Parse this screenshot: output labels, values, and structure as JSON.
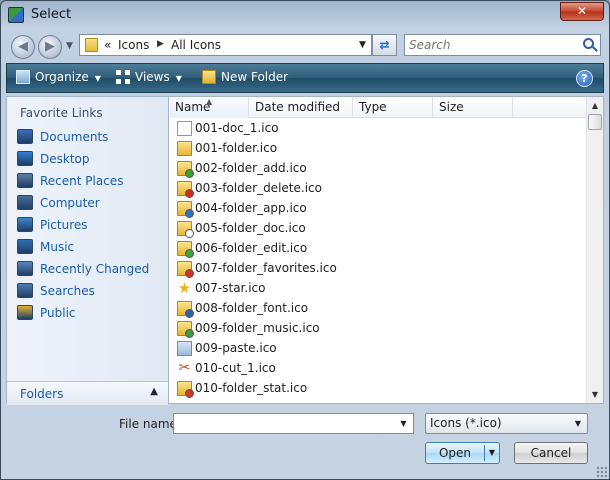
{
  "window": {
    "title": "Select",
    "close_glyph": "✕"
  },
  "address": {
    "overflow": "«",
    "parts": [
      "Icons",
      "All Icons"
    ],
    "search_placeholder": "Search"
  },
  "toolbar": {
    "organize": "Organize",
    "views": "Views",
    "new_folder": "New Folder",
    "help": "?"
  },
  "sidebar": {
    "title": "Favorite Links",
    "items": [
      {
        "label": "Documents",
        "icon": "documents-icon",
        "color": "#3a6fb6"
      },
      {
        "label": "Desktop",
        "icon": "desktop-icon",
        "color": "#2f7fd8"
      },
      {
        "label": "Recent Places",
        "icon": "recent-places-icon",
        "color": "#5f7ea3"
      },
      {
        "label": "Computer",
        "icon": "computer-icon",
        "color": "#4b6d96"
      },
      {
        "label": "Pictures",
        "icon": "pictures-icon",
        "color": "#3d87c9"
      },
      {
        "label": "Music",
        "icon": "music-icon",
        "color": "#2a6fb4"
      },
      {
        "label": "Recently Changed",
        "icon": "recently-changed-icon",
        "color": "#5b86bd"
      },
      {
        "label": "Searches",
        "icon": "searches-icon",
        "color": "#4f7cb3"
      },
      {
        "label": "Public",
        "icon": "public-folder-icon",
        "color": "#e1b234"
      }
    ],
    "folders_label": "Folders"
  },
  "columns": [
    "Name",
    "Date modified",
    "Type",
    "Size"
  ],
  "files": [
    {
      "name": "001-doc_1.ico",
      "icon": "doc"
    },
    {
      "name": "001-folder.ico",
      "icon": "folder"
    },
    {
      "name": "002-folder_add.ico",
      "icon": "folder",
      "badge": "#37a22e"
    },
    {
      "name": "003-folder_delete.ico",
      "icon": "folder",
      "badge": "#d32a1f"
    },
    {
      "name": "004-folder_app.ico",
      "icon": "folder",
      "badge": "#2f6fc6"
    },
    {
      "name": "005-folder_doc.ico",
      "icon": "folder",
      "badge": "#ffffff"
    },
    {
      "name": "006-folder_edit.ico",
      "icon": "folder",
      "badge": "#3aa63a"
    },
    {
      "name": "007-folder_favorites.ico",
      "icon": "folder",
      "badge": "#d9312a"
    },
    {
      "name": "007-star.ico",
      "icon": "star"
    },
    {
      "name": "008-folder_font.ico",
      "icon": "folder",
      "badge": "#2c62b6"
    },
    {
      "name": "009-folder_music.ico",
      "icon": "folder",
      "badge": "#3a9d43"
    },
    {
      "name": "009-paste.ico",
      "icon": "paste"
    },
    {
      "name": "010-cut_1.ico",
      "icon": "cut"
    },
    {
      "name": "010-folder_stat.ico",
      "icon": "folder",
      "badge": "#cf3b2c"
    }
  ],
  "bottom": {
    "filename_label": "File name:",
    "filename_value": "",
    "filter": "Icons (*.ico)",
    "open": "Open",
    "cancel": "Cancel"
  }
}
